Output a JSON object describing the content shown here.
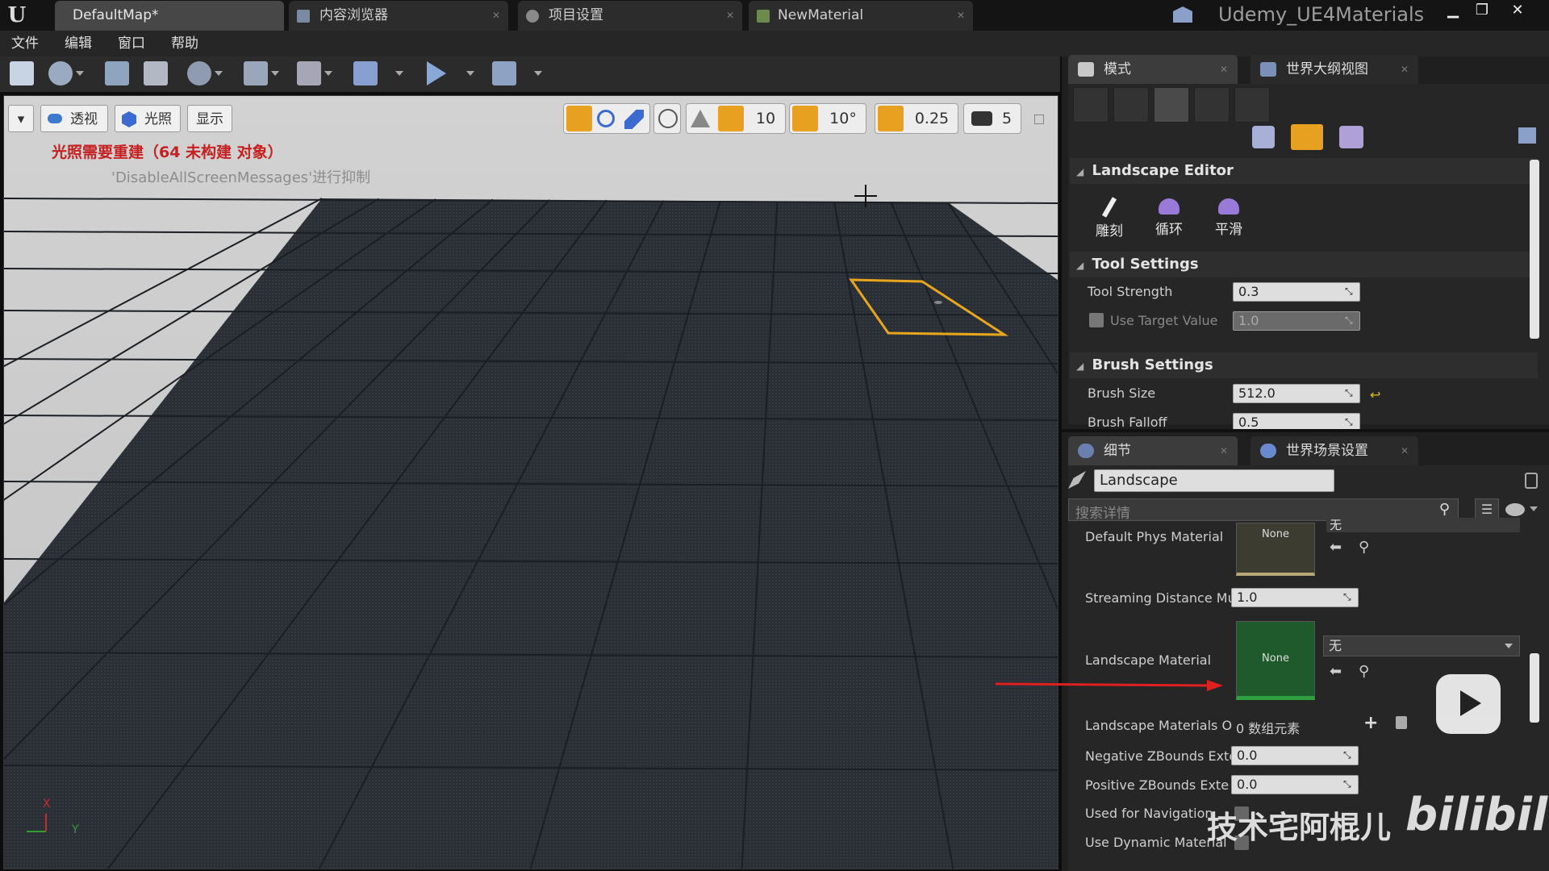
{
  "titlebar": {
    "tabs": [
      {
        "label": "DefaultMap*"
      },
      {
        "label": "内容浏览器"
      },
      {
        "label": "项目设置"
      },
      {
        "label": "NewMaterial"
      }
    ],
    "project_name": "Udemy_UE4Materials",
    "logo_text": "U"
  },
  "menubar": {
    "items": [
      "文件",
      "编辑",
      "窗口",
      "帮助"
    ]
  },
  "viewport": {
    "mode_buttons": [
      "透视",
      "光照",
      "显示"
    ],
    "snap": {
      "grid": "10",
      "rotation": "10°",
      "scale": "0.25",
      "camera_speed": "5"
    },
    "messages": {
      "lighting": "光照需要重建（64 未构建 对象）",
      "suppress": "'DisableAllScreenMessages'进行抑制"
    },
    "axis": {
      "x": "X",
      "y": "Y"
    }
  },
  "modes_panel": {
    "tabs": [
      "模式",
      "世界大纲视图"
    ],
    "landscape_editor_title": "Landscape Editor",
    "tools": [
      "雕刻",
      "循环",
      "平滑"
    ],
    "tool_settings": {
      "title": "Tool Settings",
      "tool_strength_label": "Tool Strength",
      "tool_strength": "0.3",
      "use_target_label": "Use Target Value",
      "use_target": "1.0"
    },
    "brush_settings": {
      "title": "Brush Settings",
      "size_label": "Brush Size",
      "size": "512.0",
      "falloff_label": "Brush Falloff",
      "falloff": "0.5"
    }
  },
  "details_panel": {
    "tabs": [
      "细节",
      "世界场景设置"
    ],
    "object_name": "Landscape",
    "search_placeholder": "搜索详情",
    "props": {
      "phys_material_label": "Default Phys Material",
      "phys_thumb": "None",
      "phys_value": "无",
      "streaming_label": "Streaming Distance Mu",
      "streaming": "1.0",
      "landscape_material_label": "Landscape Material",
      "landscape_thumb": "None",
      "landscape_material_value": "无",
      "overrides_label": "Landscape Materials O",
      "overrides_value": "0 数组元素",
      "neg_z_label": "Negative ZBounds Exte",
      "neg_z": "0.0",
      "pos_z_label": "Positive ZBounds Exte",
      "pos_z": "0.0",
      "nav_label": "Used for Navigation",
      "dynamic_label": "Use Dynamic Material"
    }
  },
  "watermark": {
    "text": "技术宅阿棍儿",
    "logo": "bilibili"
  }
}
